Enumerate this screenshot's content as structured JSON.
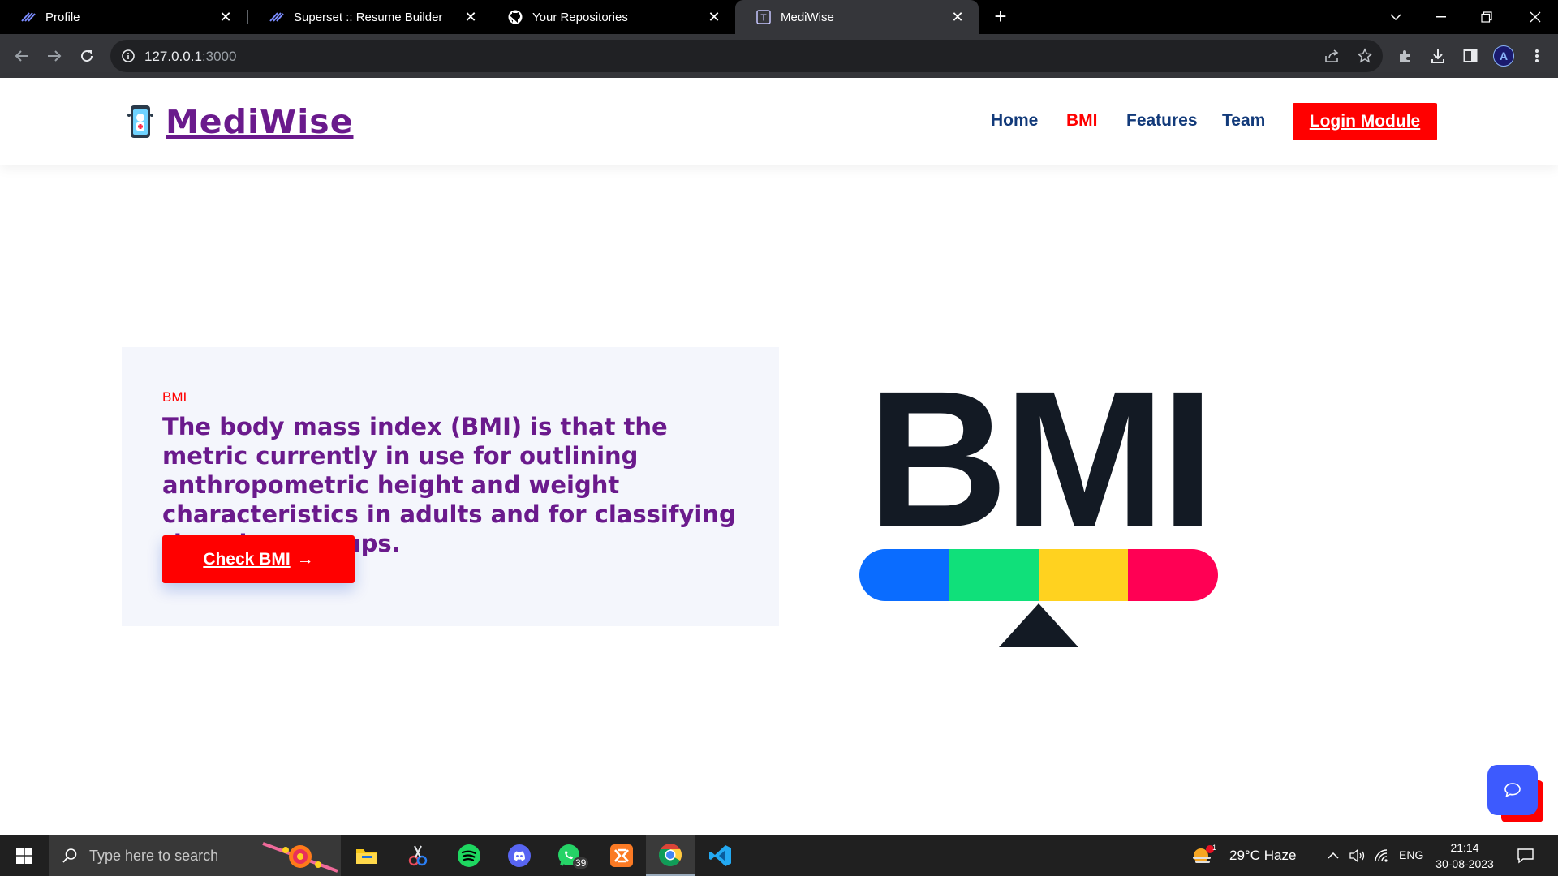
{
  "browser": {
    "tabs": [
      {
        "title": "Profile",
        "active": false
      },
      {
        "title": "Superset :: Resume Builder",
        "active": false
      },
      {
        "title": "Your Repositories",
        "active": false
      },
      {
        "title": "MediWise",
        "active": true
      }
    ],
    "url_host": "127.0.0.1",
    "url_port": ":3000"
  },
  "site": {
    "brand": "MediWise",
    "nav": {
      "home": "Home",
      "bmi": "BMI",
      "features": "Features",
      "team": "Team",
      "login": "Login Module"
    },
    "hero": {
      "kicker": "BMI",
      "text": "The body mass index (BMI) is that the metric currently in use for outlining anthropometric height and weight characteristics in adults and for classifying them into groups.",
      "button": "Check BMI",
      "button_arrow": "→",
      "graphic_word": "BMI",
      "scale_colors": [
        "#0a6cff",
        "#10e07a",
        "#ffd21f",
        "#ff0054"
      ]
    }
  },
  "taskbar": {
    "search_placeholder": "Type here to search",
    "whatsapp_badge": "39",
    "weather": "29°C  Haze",
    "weather_badge": "1",
    "lang": "ENG",
    "time": "21:14",
    "date": "30-08-2023"
  }
}
